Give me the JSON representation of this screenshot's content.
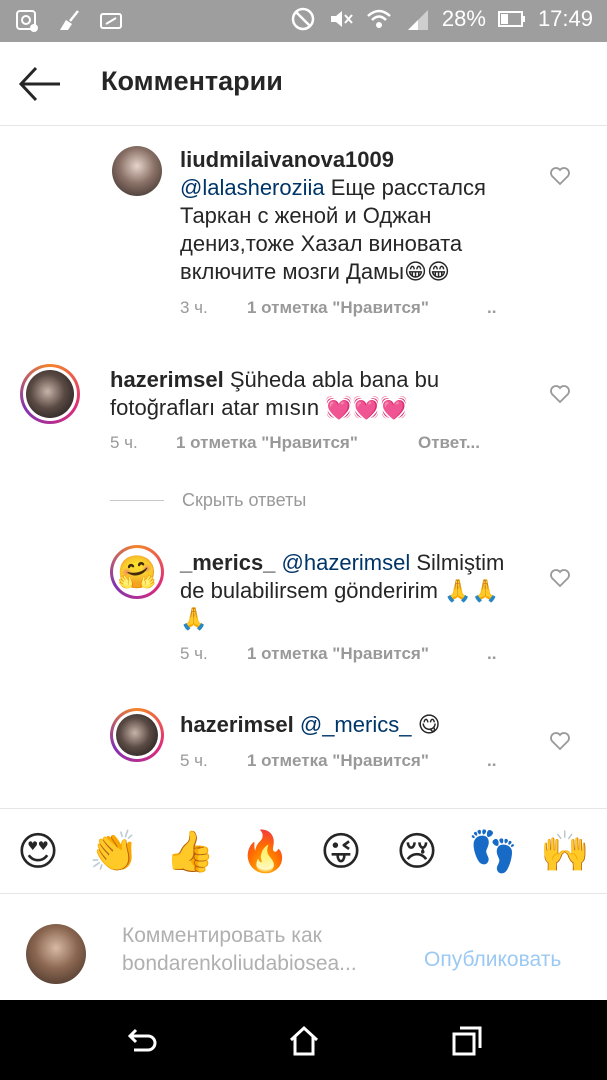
{
  "status_bar": {
    "battery": "28%",
    "time": "17:49"
  },
  "header": {
    "title": "Комментарии"
  },
  "comments": [
    {
      "username": "liudmilaivanova1009",
      "mention": "@lalasheroziia",
      "text_lines": [
        "Еще расстался",
        "Таркан с женой и Оджан",
        "дениз,тоже Хазал виновата",
        "включите мозги Дамы😁😁"
      ],
      "time": "3 ч.",
      "likes": "1 отметка \"Нравится\"",
      "more": ".."
    },
    {
      "username": "hazerimsel",
      "text_lines": [
        "Şüheda abla bana bu",
        "fotoğrafları atar mısın 💓💓💓"
      ],
      "time": "5 ч.",
      "likes": "1 отметка \"Нравится\"",
      "reply": "Ответ..."
    },
    {
      "username": "_merics_",
      "mention": "@hazerimsel",
      "text_lines": [
        "Silmiştim",
        "de bulabilirsem gönderirim 🙏🙏",
        "🙏"
      ],
      "time": "5 ч.",
      "likes": "1 отметка \"Нравится\"",
      "more": ".."
    },
    {
      "username": "hazerimsel",
      "mention": "@_merics_",
      "text_lines": [
        "😋"
      ],
      "time": "5 ч.",
      "likes": "1 отметка \"Нравится\"",
      "more": ".."
    }
  ],
  "hide_replies": "Скрыть ответы",
  "quick_emojis": [
    "😍",
    "👏",
    "👍",
    "🔥",
    "😜",
    "😢",
    "👣",
    "🙌"
  ],
  "composer": {
    "placeholder_line1": "Комментировать как",
    "placeholder_line2": "bondarenkoliudabiosea...",
    "post_label": "Опубликовать"
  },
  "colors": {
    "status_bar": "#9e9e9e",
    "mention": "#003569",
    "post_button": "#9cc9f2",
    "muted_text": "#999999"
  }
}
